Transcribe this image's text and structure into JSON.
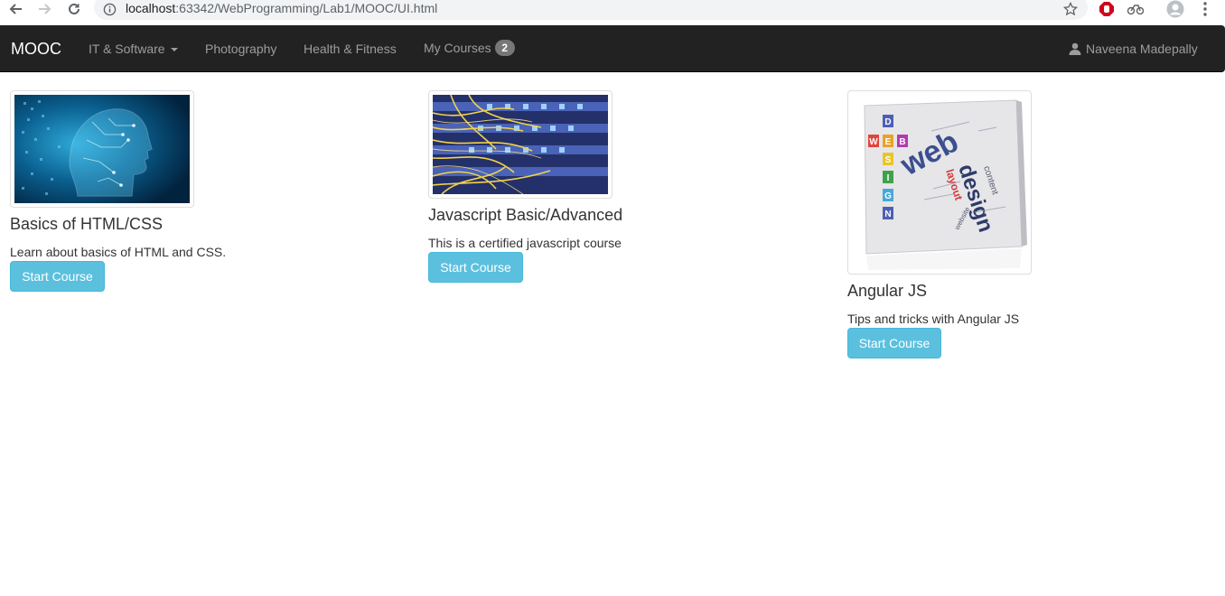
{
  "browser": {
    "url_host": "localhost",
    "url_path": ":63342/WebProgramming/Lab1/MOOC/UI.html",
    "icons": [
      "back-arrow-icon",
      "forward-arrow-icon",
      "reload-icon",
      "info-icon",
      "star-icon",
      "adblock-icon",
      "extension-icon",
      "profile-icon",
      "menu-dots-icon"
    ]
  },
  "navbar": {
    "brand": "MOOC",
    "items": [
      {
        "label": "IT & Software",
        "has_caret": true
      },
      {
        "label": "Photography"
      },
      {
        "label": "Health & Fitness"
      },
      {
        "label": "My Courses",
        "badge": "2"
      }
    ],
    "user": "Naveena Madepally",
    "user_icon": "user-icon"
  },
  "courses": [
    {
      "title": "Basics of HTML/CSS",
      "description": "Learn about basics of HTML and CSS.",
      "button": "Start Course",
      "image": "digital-head-image"
    },
    {
      "title": "Javascript Basic/Advanced",
      "description": "This is a certified javascript course",
      "button": "Start Course",
      "image": "network-cables-image"
    },
    {
      "title": "Angular JS",
      "description": "Tips and tricks with Angular JS",
      "button": "Start Course",
      "image": "web-design-box-image"
    }
  ],
  "colors": {
    "navbar_bg": "#222222",
    "nav_text": "#9d9d9d",
    "btn_info": "#5bc0de",
    "badge": "#777777"
  }
}
